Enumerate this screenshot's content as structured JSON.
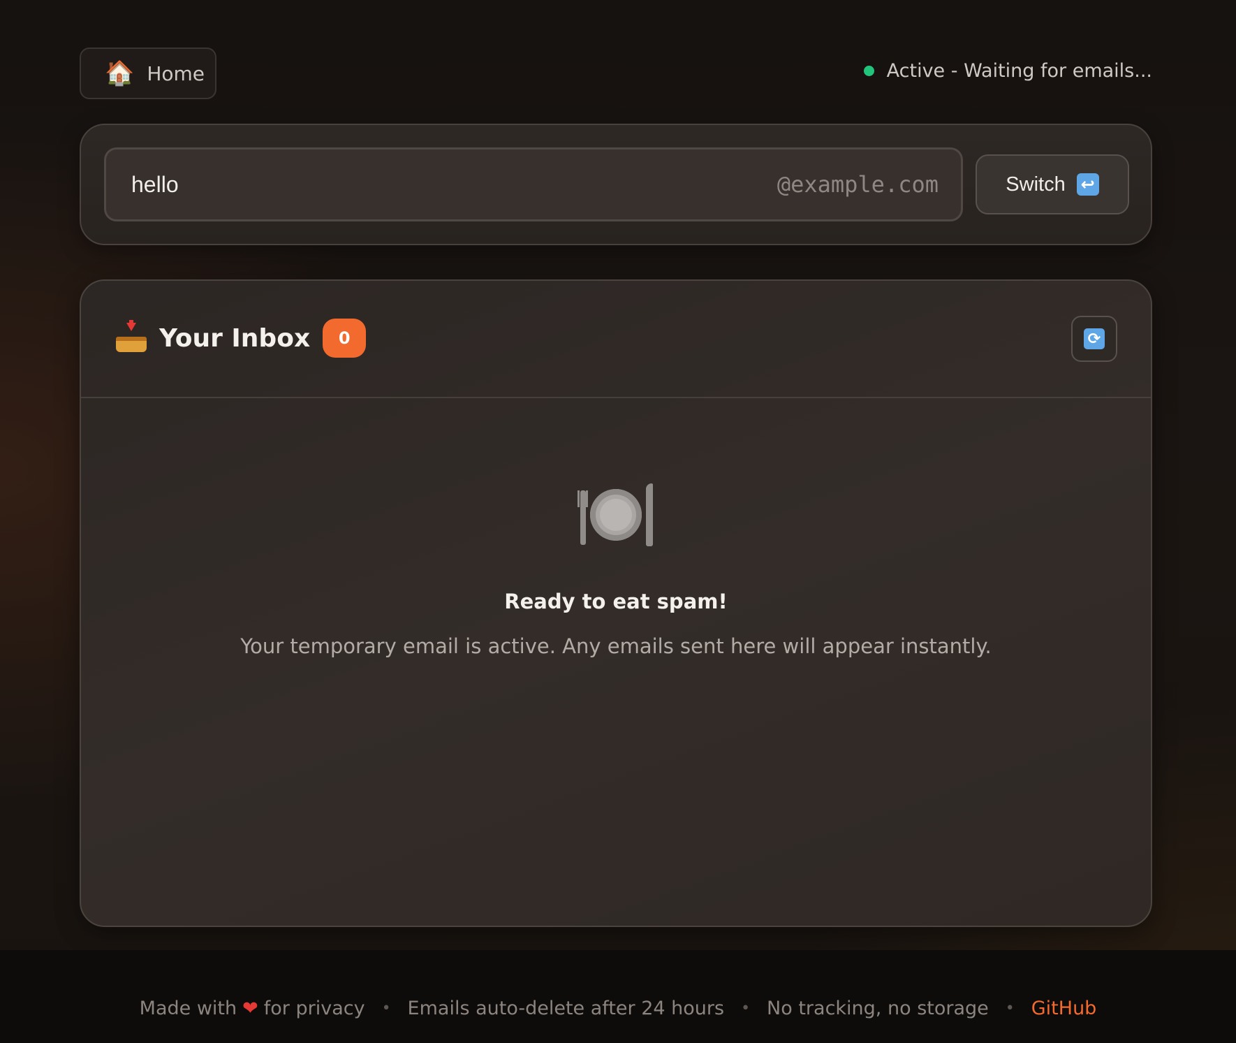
{
  "nav": {
    "home_icon": "🏠",
    "home_label": "Home"
  },
  "status": {
    "text": "Active - Waiting for emails...",
    "color": "#22c47c"
  },
  "email": {
    "username": "hello",
    "domain": "@example.com",
    "switch_label": "Switch",
    "switch_icon": "↩"
  },
  "inbox": {
    "title": "Your Inbox",
    "count": "0",
    "refresh_icon": "⟳",
    "empty_title": "Ready to eat spam!",
    "empty_text": "Your temporary email is active. Any emails sent here will appear instantly."
  },
  "footer": {
    "made_with_prefix": "Made with",
    "heart": "❤",
    "made_with_suffix": "for privacy",
    "auto_delete": "Emails auto-delete after 24 hours",
    "no_tracking": "No tracking, no storage",
    "github": "GitHub",
    "separator": "•"
  },
  "colors": {
    "accent": "#f26a2e",
    "status_active": "#22c47c"
  }
}
